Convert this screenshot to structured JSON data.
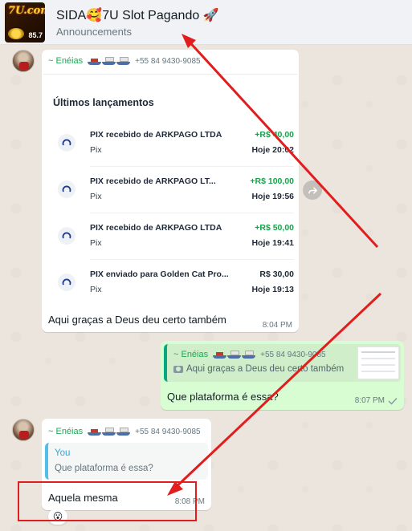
{
  "header": {
    "title": "SIDA🥰7U Slot Pagando 🚀",
    "subtitle": "Announcements",
    "logo_top": "7U.com",
    "logo_num": "85.7"
  },
  "messages": [
    {
      "sender": "~ Enéias",
      "phone": "+55 84 9430-9085",
      "inner_title": "Últimos lançamentos",
      "transactions": [
        {
          "title": "PIX recebido de ARKPAGO LTDA",
          "method": "Pix",
          "amount": "+R$ 40,00",
          "date": "Hoje 20:02",
          "type": "pos"
        },
        {
          "title": "PIX recebido de ARKPAGO LT...",
          "method": "Pix",
          "amount": "+R$ 100,00",
          "date": "Hoje 19:56",
          "type": "pos"
        },
        {
          "title": "PIX recebido de ARKPAGO LTDA",
          "method": "Pix",
          "amount": "+R$ 50,00",
          "date": "Hoje 19:41",
          "type": "pos"
        },
        {
          "title": "PIX enviado para Golden Cat Pro...",
          "method": "Pix",
          "amount": "R$ 30,00",
          "date": "Hoje 19:13",
          "type": "neg"
        }
      ],
      "caption": "Aqui graças a Deus deu certo também",
      "time": "8:04 PM"
    },
    {
      "quoted_sender": "~ Enéias",
      "quoted_phone": "+55 84 9430-9085",
      "quoted_text": "Aqui graças a Deus deu certo também",
      "text": "Que plataforma é essa?",
      "time": "8:07 PM"
    },
    {
      "sender": "~ Enéias",
      "phone": "+55 84 9430-9085",
      "quoted_sender": "You",
      "quoted_text": "Que plataforma é essa?",
      "text": "Aquela mesma",
      "time": "8:08 PM",
      "reaction": "😮"
    }
  ],
  "colors": {
    "annotation_red": "#e11d1d",
    "sender_green": "#1fa855",
    "outgoing_bubble": "#d9fdd3",
    "chat_bg": "#ece5dd"
  }
}
